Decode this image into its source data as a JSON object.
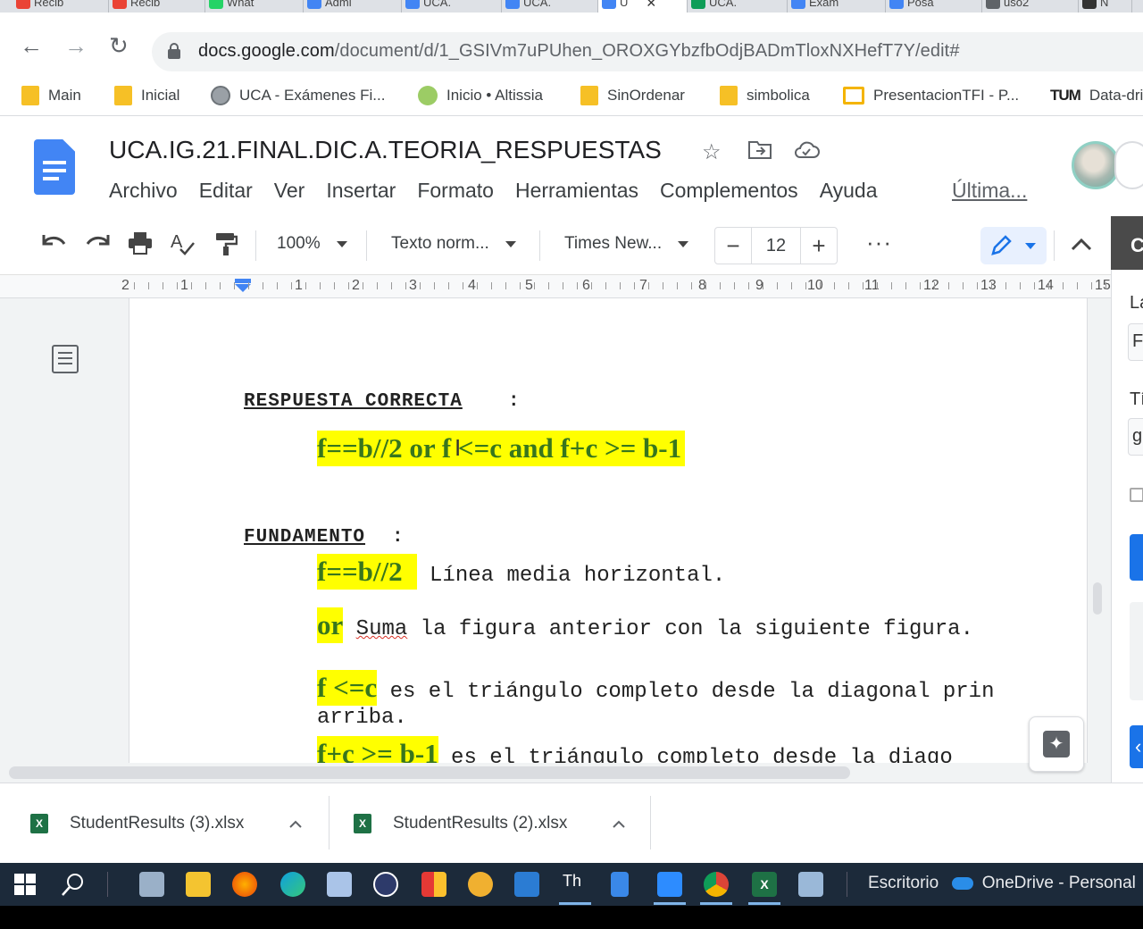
{
  "browser": {
    "tabs": [
      {
        "label": "Recib",
        "color": "#ea4335"
      },
      {
        "label": "Recib",
        "color": "#ea4335"
      },
      {
        "label": "What",
        "color": "#25d366"
      },
      {
        "label": "Admi",
        "color": "#4285f4"
      },
      {
        "label": "UCA.",
        "color": "#4285f4"
      },
      {
        "label": "UCA.",
        "color": "#4285f4"
      },
      {
        "label": "U",
        "color": "#4285f4",
        "active": true
      },
      {
        "label": "UCA.",
        "color": "#0f9d58"
      },
      {
        "label": "Exam",
        "color": "#4285f4"
      },
      {
        "label": "Posa",
        "color": "#4285f4"
      },
      {
        "label": "uso2",
        "color": "#5f6368"
      },
      {
        "label": "N",
        "color": "#333333"
      }
    ],
    "active_tab_close": "✕",
    "url_host": "docs.google.com",
    "url_path": "/document/d/1_GSIVm7uPUhen_OROXGYbzfbOdjBADmTloxNXHefT7Y/edit#",
    "bookmarks": [
      {
        "label": "Main",
        "icon": "folder-icon"
      },
      {
        "label": "Inicial",
        "icon": "folder-icon"
      },
      {
        "label": "UCA - Exámenes Fi...",
        "icon": "globe-icon"
      },
      {
        "label": "Inicio • Altissia",
        "icon": "leaf-icon"
      },
      {
        "label": "SinOrdenar",
        "icon": "folder-icon"
      },
      {
        "label": "simbolica",
        "icon": "folder-icon"
      },
      {
        "label": "PresentacionTFI - P...",
        "icon": "slides-icon"
      },
      {
        "label": "Data-dri",
        "icon": "tum-icon"
      }
    ]
  },
  "docs": {
    "title": "UCA.IG.21.FINAL.DIC.A.TEORIA_RESPUESTAS",
    "menu": [
      "Archivo",
      "Editar",
      "Ver",
      "Insertar",
      "Formato",
      "Herramientas",
      "Complementos",
      "Ayuda"
    ],
    "last_edit": "Última...",
    "toolbar": {
      "zoom": "100%",
      "style": "Texto norm...",
      "font": "Times New...",
      "font_size": "12",
      "more": "···"
    },
    "side_panel_letter": "C",
    "ruler_numbers": [
      "2",
      "1",
      "1",
      "2",
      "3",
      "4",
      "5",
      "6",
      "7",
      "8",
      "9",
      "10",
      "11",
      "12",
      "13",
      "14",
      "15"
    ]
  },
  "document": {
    "heading_answer": "RESPUESTA CORRECTA",
    "heading_colon": ":",
    "answer_part1": "f==b//2 ",
    "answer_or": "or ",
    "answer_part2": "f <=c  and f+c >= b-1",
    "heading_basis": "FUNDAMENTO",
    "basis_colon": ":",
    "items": [
      {
        "code": "f==b//2",
        "text": " Línea media horizontal."
      },
      {
        "code": "or",
        "text": " Suma la figura anterior con la siguiente figura."
      },
      {
        "code": "f <=c",
        "text": " es el triángulo completo desde la diagonal prin"
      },
      {
        "code": "",
        "text": "arriba."
      },
      {
        "code": "f+c >= b-1",
        "text": " es el triángulo completo desde la diago"
      }
    ],
    "wavy_word": "Suma"
  },
  "side_panel": {
    "labels": [
      "La",
      "F",
      "Tí",
      "g"
    ]
  },
  "downloads": [
    {
      "label": "StudentResults (3).xlsx"
    },
    {
      "label": "StudentResults (2).xlsx"
    }
  ],
  "taskbar": {
    "text": "Escritorio",
    "onedrive": "OneDrive - Personal"
  }
}
